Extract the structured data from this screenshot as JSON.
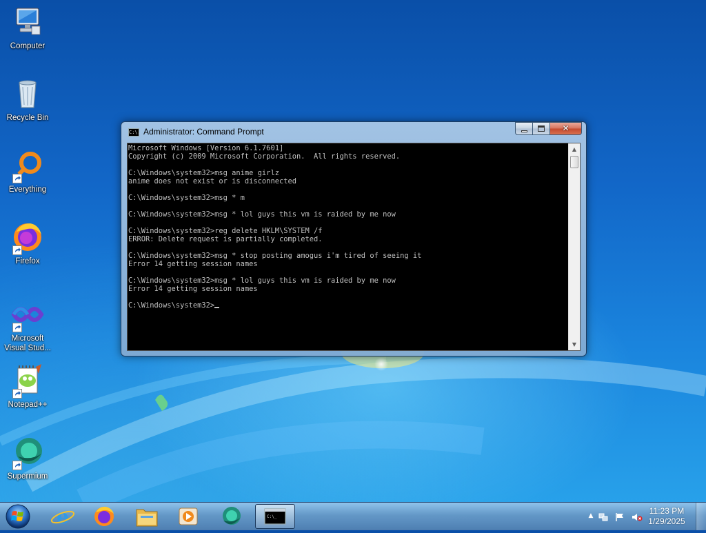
{
  "desktop": {
    "icons": [
      {
        "label": "Computer",
        "icon": "computer-icon"
      },
      {
        "label": "Recycle Bin",
        "icon": "recycle-bin-icon"
      },
      {
        "label": "Everything",
        "icon": "everything-icon"
      },
      {
        "label": "Firefox",
        "icon": "firefox-icon"
      },
      {
        "label": "Microsoft Visual Stud...",
        "icon": "visual-studio-icon"
      },
      {
        "label": "Notepad++",
        "icon": "notepad-plus-plus-icon"
      },
      {
        "label": "Supermium",
        "icon": "supermium-icon"
      }
    ]
  },
  "window": {
    "title": "Administrator: Command Prompt",
    "icon_text": "C:\\.",
    "console_lines": [
      "Microsoft Windows [Version 6.1.7601]",
      "Copyright (c) 2009 Microsoft Corporation.  All rights reserved.",
      "",
      "C:\\Windows\\system32>msg anime girlz",
      "anime does not exist or is disconnected",
      "",
      "C:\\Windows\\system32>msg * m",
      "",
      "C:\\Windows\\system32>msg * lol guys this vm is raided by me now",
      "",
      "C:\\Windows\\system32>reg delete HKLM\\SYSTEM /f",
      "ERROR: Delete request is partially completed.",
      "",
      "C:\\Windows\\system32>msg * stop posting amogus i'm tired of seeing it",
      "Error 14 getting session names",
      "",
      "C:\\Windows\\system32>msg * lol guys this vm is raided by me now",
      "Error 14 getting session names",
      ""
    ],
    "prompt": "C:\\Windows\\system32>"
  },
  "taskbar": {
    "pinned": [
      "internet-explorer-icon",
      "firefox-icon",
      "file-explorer-icon",
      "media-player-icon",
      "supermium-icon",
      "command-prompt-icon"
    ],
    "active": "command-prompt-icon",
    "tray_icons": [
      "show-hidden-icons-icon",
      "network-icon",
      "action-center-flag-icon",
      "volume-muted-icon"
    ],
    "time": "11:23 PM",
    "date": "1/29/2025"
  },
  "colors": {
    "console_bg": "#000000",
    "console_text": "#c0c0c0",
    "desktop_blue": "#1267c8"
  }
}
